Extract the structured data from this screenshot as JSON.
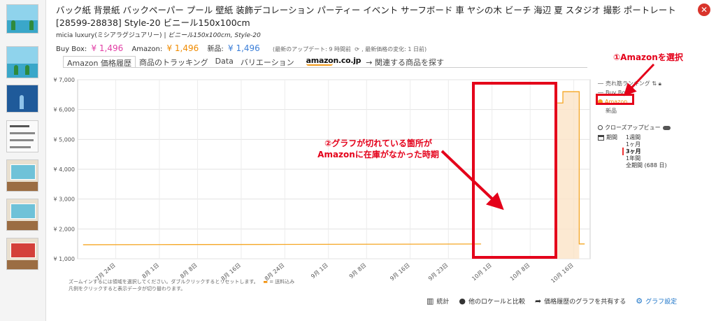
{
  "product": {
    "title": "バック紙 背景紙 バックペーパー プール 壁紙 装飾デコレーション パーティー イベント サーフボード 車 ヤシの木 ビーチ 海辺 夏 スタジオ 撮影 ポートレート [28599-28838] Style-20 ビニール150x100cm",
    "brand": "micia luxury(ミシアラグジュアリー)",
    "brand_sep": "|",
    "variant": "ビニール150x100cm, Style-20"
  },
  "prices": {
    "buybox_label": "Buy Box:",
    "buybox_value": "¥ 1,496",
    "amazon_label": "Amazon:",
    "amazon_value": "¥ 1,496",
    "new_label": "新品:",
    "new_value": "¥ 1,496",
    "last_update": "(最新のアップデート: 9 時間前",
    "last_change": ", 最新価格の変化: 1 日前)"
  },
  "tabs": [
    {
      "label": "Amazon 価格履歴",
      "active": true
    },
    {
      "label": "商品のトラッキング",
      "active": false
    },
    {
      "label": "Data",
      "active": false
    },
    {
      "label": "バリエーション",
      "active": false
    }
  ],
  "amazon_logo": "amazon.co.jp",
  "related": "→ 関連する商品を探す",
  "chart_data": {
    "type": "line",
    "y_ticks": [
      "¥ 7,000",
      "¥ 6,000",
      "¥ 5,000",
      "¥ 4,000",
      "¥ 3,000",
      "¥ 2,000",
      "¥ 1,000"
    ],
    "ylim": [
      1000,
      7000
    ],
    "x_ticks": [
      "7月 24日",
      "8月 1日",
      "8月 8日",
      "8月 16日",
      "8月 24日",
      "9月 1日",
      "9月 8日",
      "9月 16日",
      "9月 23日",
      "10月 1日",
      "10月 8日",
      "10月 16日"
    ],
    "series": [
      {
        "name": "Amazon",
        "color": "#f5a623",
        "segments": [
          [
            [
              "7月 18日",
              1470
            ],
            [
              "8月 1日",
              1475
            ],
            [
              "8月 24日",
              1480
            ],
            [
              "9月 16日",
              1490
            ],
            [
              "9月 29日",
              1495
            ]
          ],
          [
            [
              "10月 13日",
              6220
            ],
            [
              "10月 14日",
              6220
            ],
            [
              "10月 14日",
              6600
            ],
            [
              "10月 17日",
              6600
            ],
            [
              "10月 17日",
              1496
            ],
            [
              "10月 18日",
              1496
            ]
          ]
        ]
      }
    ],
    "grid": true
  },
  "legend": {
    "sales_rank": "売れ筋ランキング",
    "buybox": "Buy Box",
    "amazon": "Amazon",
    "new": "新品",
    "closeup": "クローズアップビュー",
    "period_label": "期間",
    "periods": [
      "1週間",
      "1ヶ月",
      "3ヶ月",
      "1年間",
      "全期間 (688 日)"
    ],
    "selected_period": "3ヶ月"
  },
  "annotations": {
    "ann1": "①Amazonを選択",
    "ann2_line1": "②グラフが切れている箇所が",
    "ann2_line2": "Amazonに在庫がなかった時期",
    "color": "#e4001a"
  },
  "footnote": {
    "line1": "ズームインするには領域を選択してください。ダブルクリックするとリセットします。",
    "shipping": "= 送料込み",
    "line2": "凡例をクリックすると表示データが切り替わります。"
  },
  "footer": {
    "stats": "統計",
    "compare": "他のロケールと比較",
    "share": "価格履歴のグラフを共有する",
    "settings": "グラフ設定"
  }
}
